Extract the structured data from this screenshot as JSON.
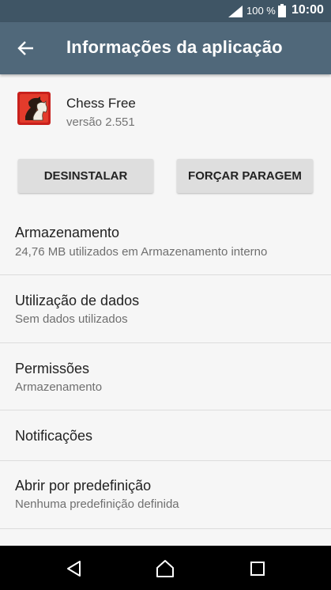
{
  "status_bar": {
    "signal_icon": "signal-icon",
    "battery_text": "100 %",
    "battery_icon": "battery-icon",
    "time": "10:00"
  },
  "app_bar": {
    "back_icon": "arrow-left-icon",
    "title": "Informações da aplicação"
  },
  "app": {
    "icon": "chess-knight-icon",
    "name": "Chess Free",
    "version": "versão 2.551"
  },
  "buttons": {
    "uninstall": "DESINSTALAR",
    "force_stop": "FORÇAR PARAGEM"
  },
  "items": [
    {
      "title": "Armazenamento",
      "subtitle": "24,76 MB utilizados em Armazenamento interno"
    },
    {
      "title": "Utilização de dados",
      "subtitle": "Sem dados utilizados"
    },
    {
      "title": "Permissões",
      "subtitle": "Armazenamento"
    },
    {
      "title": "Notificações",
      "subtitle": ""
    },
    {
      "title": "Abrir por predefinição",
      "subtitle": "Nenhuma predefinição definida"
    }
  ],
  "nav_bar": {
    "back_icon": "triangle-back-icon",
    "home_icon": "home-icon",
    "recents_icon": "square-recents-icon"
  },
  "colors": {
    "status_bar": "#3f5565",
    "app_bar": "#50687a",
    "background": "#f6f6f6",
    "button": "#dedede"
  }
}
